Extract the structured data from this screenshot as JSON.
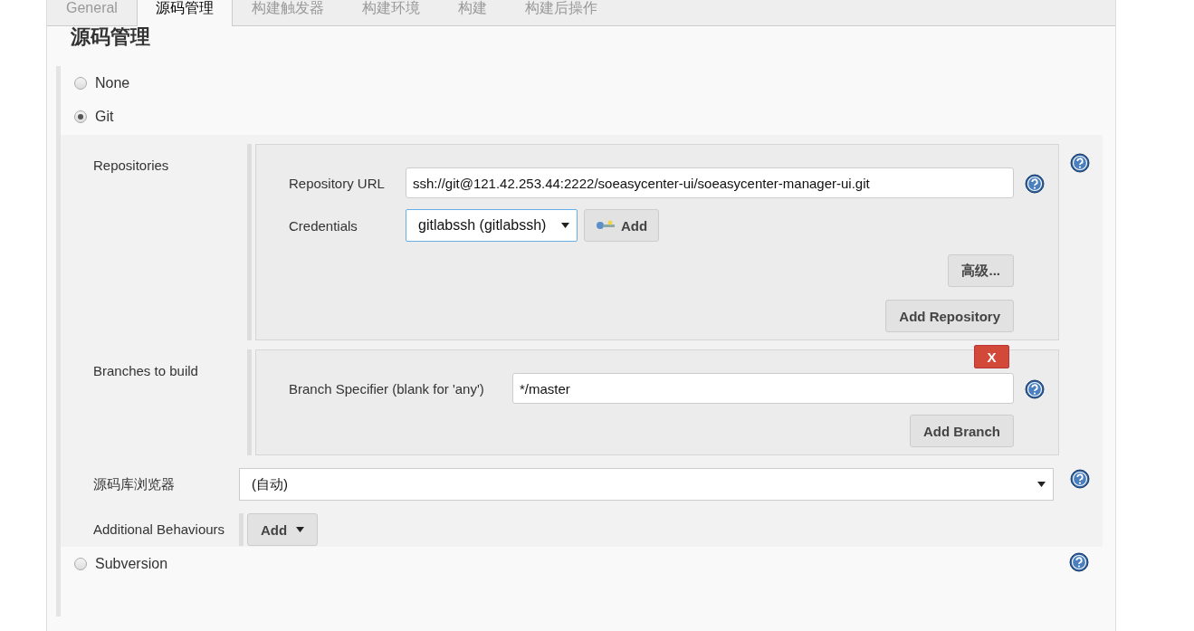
{
  "tabs": [
    {
      "label": "General",
      "selected": false
    },
    {
      "label": "源码管理",
      "selected": true
    },
    {
      "label": "构建触发器",
      "selected": false
    },
    {
      "label": "构建环境",
      "selected": false
    },
    {
      "label": "构建",
      "selected": false
    },
    {
      "label": "构建后操作",
      "selected": false
    }
  ],
  "heading": "源码管理",
  "scm_options": [
    {
      "label": "None",
      "selected": false
    },
    {
      "label": "Git",
      "selected": true
    },
    {
      "label": "Subversion",
      "selected": false
    }
  ],
  "git": {
    "repositories": {
      "label": "Repositories",
      "url_label": "Repository URL",
      "url": "ssh://git@121.42.253.44:2222/soeasycenter-ui/soeasycenter-manager-ui.git",
      "credentials_label": "Credentials",
      "credentials": "gitlabssh (gitlabssh)",
      "credentials_add": "Add",
      "advanced": "高级...",
      "add_repository": "Add Repository"
    },
    "branches": {
      "label": "Branches to build",
      "delete": "X",
      "specifier_label": "Branch Specifier (blank for 'any')",
      "specifier": "*/master",
      "add_branch": "Add Branch"
    },
    "browser": {
      "label": "源码库浏览器",
      "value": "(自动)"
    },
    "behaviours": {
      "label": "Additional Behaviours",
      "add": "Add"
    }
  }
}
